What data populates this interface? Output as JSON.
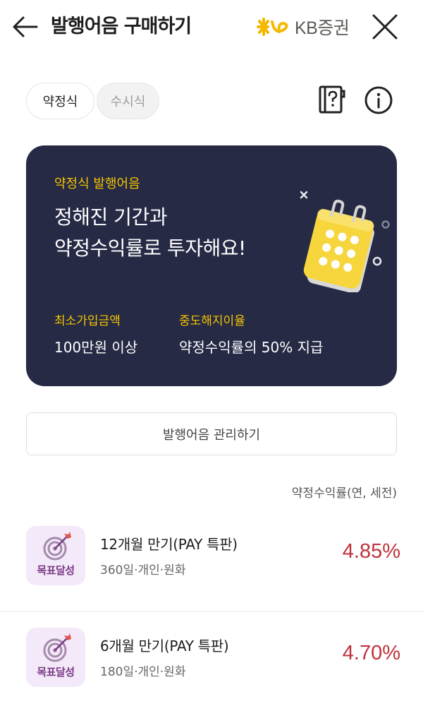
{
  "header": {
    "title": "발행어음 구매하기",
    "brand": "KB증권"
  },
  "tabs": [
    {
      "label": "약정식",
      "selected": true
    },
    {
      "label": "수시식",
      "selected": false
    }
  ],
  "card": {
    "subtitle": "약정식 발행어음",
    "headline_line1": "정해진 기간과",
    "headline_line2": "약정수익률로 투자해요!",
    "stats": [
      {
        "label": "최소가입금액",
        "value": "100만원 이상"
      },
      {
        "label": "중도해지이율",
        "value": "약정수익률의 50% 지급"
      }
    ]
  },
  "manage_button": "발행어음 관리하기",
  "rate_caption": "약정수익률(연, 세전)",
  "products": [
    {
      "badge": "목표달성",
      "name": "12개월 만기(PAY 특판)",
      "meta": "360일·개인·원화",
      "rate": "4.85%"
    },
    {
      "badge": "목표달성",
      "name": "6개월 만기(PAY 특판)",
      "meta": "180일·개인·원화",
      "rate": "4.70%"
    }
  ],
  "icons": {
    "back": "arrow-left-icon",
    "close": "close-icon",
    "glossary": "glossary-book-icon",
    "info": "info-icon",
    "calendar": "calendar-icon",
    "target": "target-icon"
  },
  "colors": {
    "card_background": "#262a45",
    "highlight_yellow": "#f5c400",
    "rate_red": "#c0313c",
    "badge_background": "#f3e9f8",
    "badge_text": "#7a3a86"
  }
}
